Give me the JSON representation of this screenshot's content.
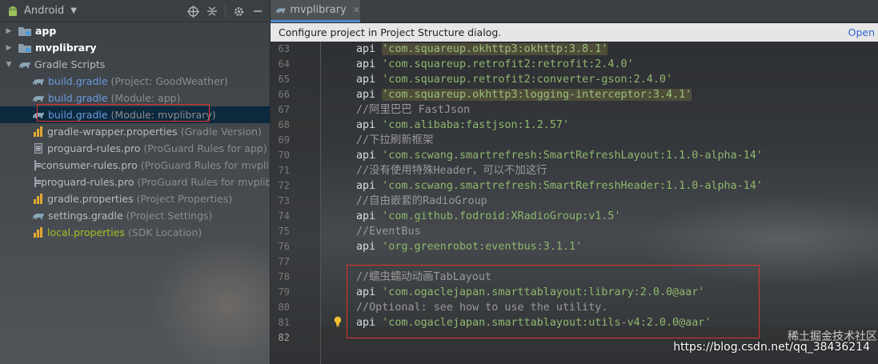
{
  "project_panel": {
    "view_mode": "Android",
    "tree": [
      {
        "name": "app",
        "bold": true,
        "expanded": false,
        "icon": "module-folder-icon"
      },
      {
        "name": "mvplibrary",
        "bold": true,
        "expanded": false,
        "icon": "library-module-icon"
      },
      {
        "name": "Gradle Scripts",
        "bold": false,
        "expanded": true,
        "icon": "gradle-icon"
      },
      {
        "name": "build.gradle",
        "hint": "(Project: GoodWeather)",
        "icon": "gradle-icon",
        "color": "blue"
      },
      {
        "name": "build.gradle",
        "hint": "(Module: app)",
        "icon": "gradle-icon",
        "color": "blue"
      },
      {
        "name": "build.gradle",
        "hint": "(Module: mvplibrary)",
        "icon": "gradle-icon",
        "color": "blue",
        "selected": true
      },
      {
        "name": "gradle-wrapper.properties",
        "hint": "(Gradle Version)",
        "icon": "properties-file-icon",
        "color": "default"
      },
      {
        "name": "proguard-rules.pro",
        "hint": "(ProGuard Rules for app)",
        "icon": "file-icon",
        "color": "default"
      },
      {
        "name": "consumer-rules.pro",
        "hint": "(ProGuard Rules for mvplib",
        "icon": "file-icon",
        "color": "default"
      },
      {
        "name": "proguard-rules.pro",
        "hint": "(ProGuard Rules for mvplib",
        "icon": "file-icon",
        "color": "default"
      },
      {
        "name": "gradle.properties",
        "hint": "(Project Properties)",
        "icon": "properties-file-icon",
        "color": "default"
      },
      {
        "name": "settings.gradle",
        "hint": "(Project Settings)",
        "icon": "gradle-icon",
        "color": "default"
      },
      {
        "name": "local.properties",
        "hint": "(SDK Location)",
        "icon": "properties-file-icon",
        "color": "green"
      }
    ]
  },
  "editor": {
    "tab_title": "mvplibrary",
    "notification": "Configure project in Project Structure dialog.",
    "notification_action": "Open",
    "lines": [
      {
        "n": "63",
        "parts": [
          {
            "t": "kw",
            "v": "api "
          },
          {
            "t": "strhl",
            "v": "'com.squareup.okhttp3:okhttp:3.8.1'"
          }
        ]
      },
      {
        "n": "64",
        "parts": [
          {
            "t": "kw",
            "v": "api "
          },
          {
            "t": "str",
            "v": "'com.squareup.retrofit2:retrofit:2.4.0'"
          }
        ]
      },
      {
        "n": "65",
        "parts": [
          {
            "t": "kw",
            "v": "api "
          },
          {
            "t": "str",
            "v": "'com.squareup.retrofit2:converter-gson:2.4.0'"
          }
        ]
      },
      {
        "n": "66",
        "parts": [
          {
            "t": "kw",
            "v": "api "
          },
          {
            "t": "strhl",
            "v": "'com.squareup.okhttp3:logging-interceptor:3.4.1'"
          }
        ]
      },
      {
        "n": "67",
        "parts": [
          {
            "t": "cmt",
            "v": "//阿里巴巴 FastJson"
          }
        ]
      },
      {
        "n": "68",
        "parts": [
          {
            "t": "kw",
            "v": "api "
          },
          {
            "t": "str",
            "v": "'com.alibaba:fastjson:1.2.57'"
          }
        ]
      },
      {
        "n": "69",
        "parts": [
          {
            "t": "cmt",
            "v": "//下拉刷新框架"
          }
        ]
      },
      {
        "n": "70",
        "parts": [
          {
            "t": "kw",
            "v": "api "
          },
          {
            "t": "str",
            "v": "'com.scwang.smartrefresh:SmartRefreshLayout:1.1.0-alpha-14'"
          }
        ]
      },
      {
        "n": "71",
        "parts": [
          {
            "t": "cmt",
            "v": "//没有使用特殊Header，可以不加这行"
          }
        ]
      },
      {
        "n": "72",
        "parts": [
          {
            "t": "kw",
            "v": "api "
          },
          {
            "t": "str",
            "v": "'com.scwang.smartrefresh:SmartRefreshHeader:1.1.0-alpha-14'"
          }
        ]
      },
      {
        "n": "73",
        "parts": [
          {
            "t": "cmt",
            "v": "//自由嵌套的RadioGroup"
          }
        ]
      },
      {
        "n": "74",
        "parts": [
          {
            "t": "kw",
            "v": "api "
          },
          {
            "t": "str",
            "v": "'com.github.fodroid:XRadioGroup:v1.5'"
          }
        ]
      },
      {
        "n": "75",
        "parts": [
          {
            "t": "cmt",
            "v": "//EventBus"
          }
        ]
      },
      {
        "n": "76",
        "parts": [
          {
            "t": "kw",
            "v": "api "
          },
          {
            "t": "str",
            "v": "'org.greenrobot:eventbus:3.1.1'"
          }
        ]
      },
      {
        "n": "77",
        "parts": []
      },
      {
        "n": "78",
        "parts": [
          {
            "t": "cmt",
            "v": "//蠕虫蠕动动画TabLayout"
          }
        ]
      },
      {
        "n": "79",
        "parts": [
          {
            "t": "kw",
            "v": "api "
          },
          {
            "t": "str",
            "v": "'com.ogaclejapan.smarttablayout:library:2.0.0@aar'"
          }
        ]
      },
      {
        "n": "80",
        "parts": [
          {
            "t": "cmt",
            "v": "//Optional: see how to use the utility."
          }
        ]
      },
      {
        "n": "81",
        "parts": [
          {
            "t": "kw",
            "v": "api "
          },
          {
            "t": "str",
            "v": "'com.ogaclejapan.smarttablayout:utils-v4:2.0.0@aar'"
          }
        ]
      },
      {
        "n": "82",
        "parts": []
      }
    ],
    "watermark": "https://blog.csdn.net/qq_38436214",
    "watermark_logo": "稀土掘金技术社区"
  },
  "colors": {
    "selection": "#0d293e",
    "annotation_red": "#e0322c",
    "string_green": "#8fb86d",
    "comment_gray": "#9a9a9a",
    "tab_underline": "#4a88c7"
  }
}
